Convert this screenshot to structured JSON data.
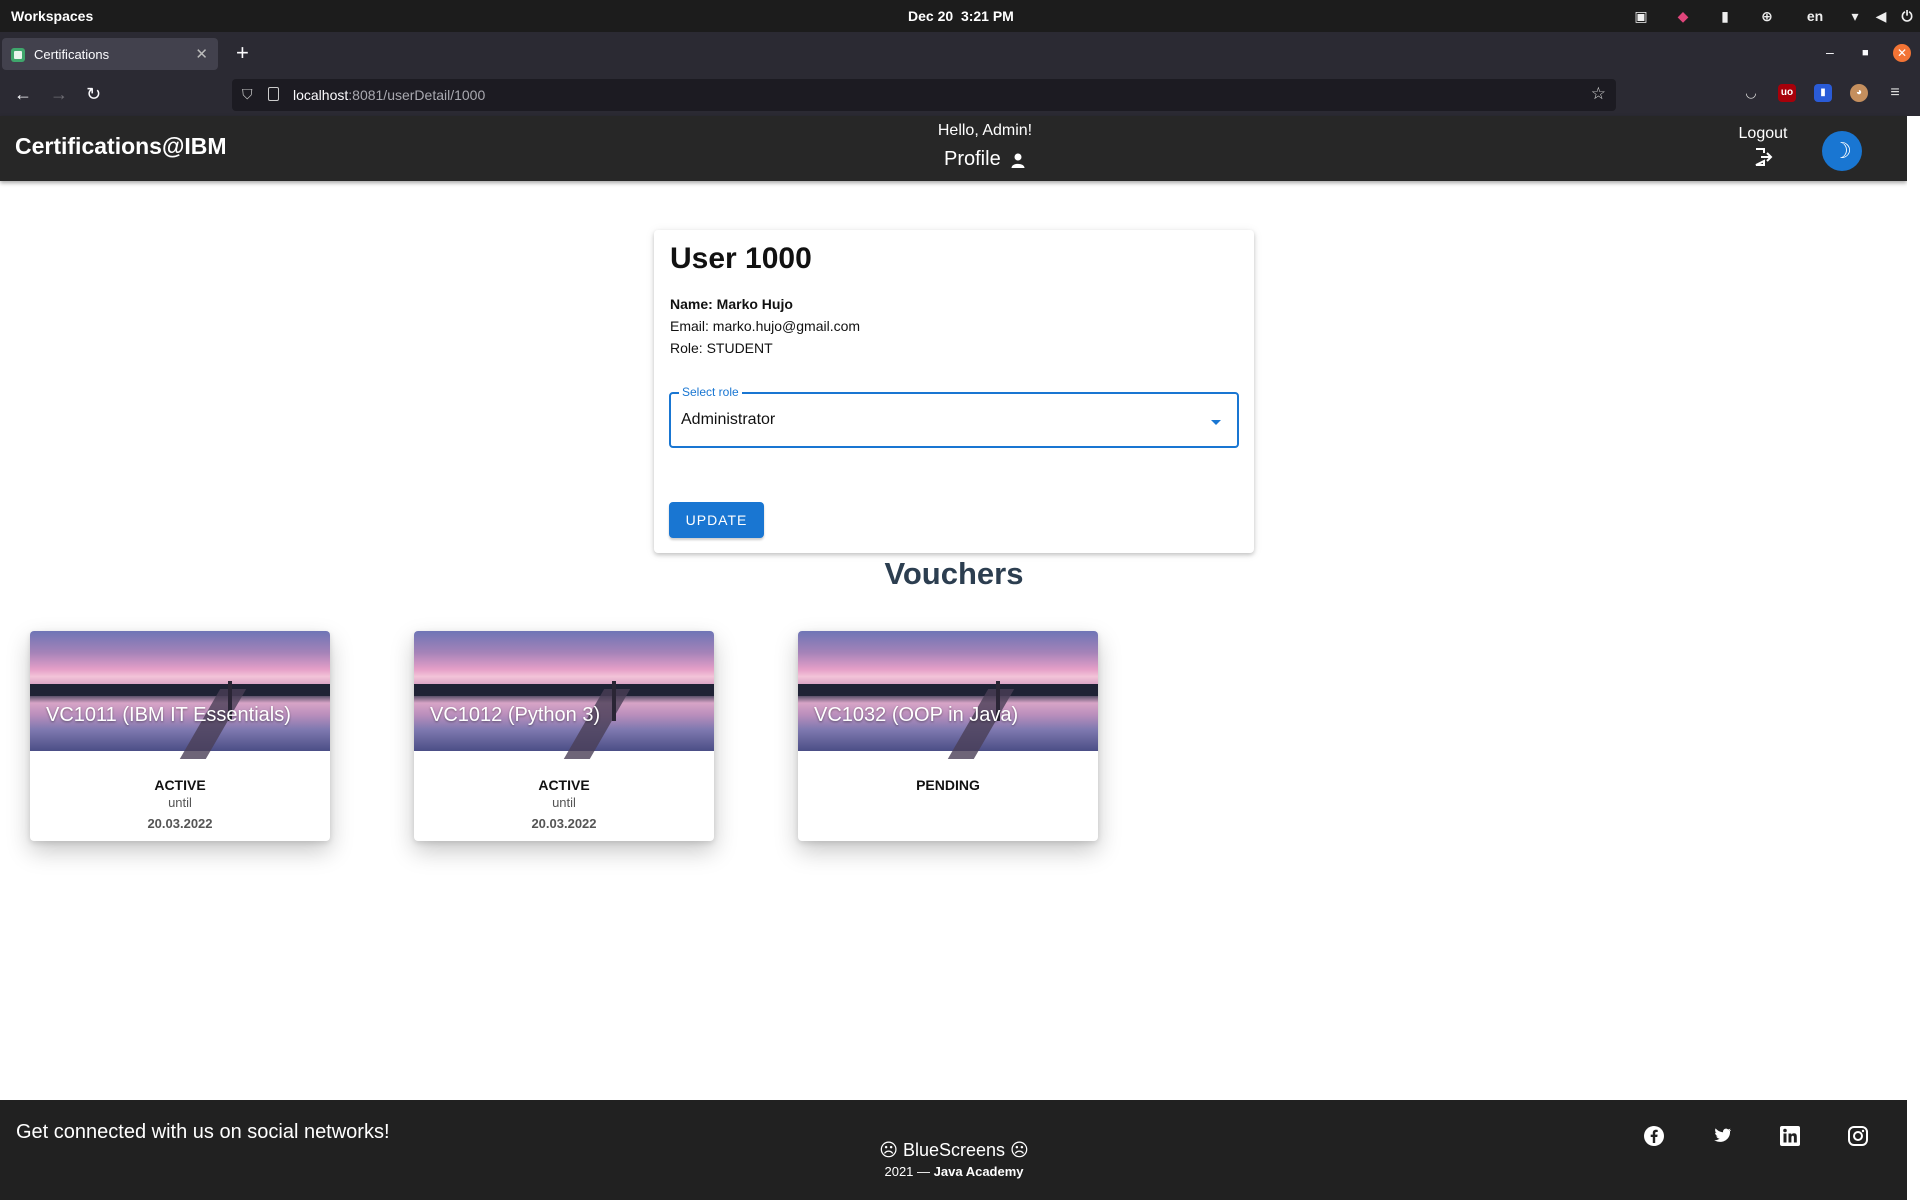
{
  "os": {
    "workspaces": "Workspaces",
    "date": "Dec 20",
    "time": "3:21 PM",
    "lang": "en"
  },
  "browser": {
    "tab_title": "Certifications",
    "url_host": "localhost",
    "url_rest": ":8081/userDetail/1000"
  },
  "header": {
    "brand": "Certifications@IBM",
    "greeting": "Hello, Admin!",
    "profile_label": "Profile",
    "logout_label": "Logout",
    "theme_icon": "moon-icon"
  },
  "user": {
    "title": "User 1000",
    "name_line": "Name: Marko Hujo",
    "email_line": "Email: marko.hujo@gmail.com",
    "role_line": "Role: STUDENT",
    "select_label": "Select role",
    "select_value": "Administrator",
    "update_label": "UPDATE"
  },
  "vouchers": {
    "title": "Vouchers",
    "items": [
      {
        "title": "VC1011 (IBM IT Essentials)",
        "status": "ACTIVE",
        "until": "until",
        "date": "20.03.2022"
      },
      {
        "title": "VC1012 (Python 3)",
        "status": "ACTIVE",
        "until": "until",
        "date": "20.03.2022"
      },
      {
        "title": "VC1032 (OOP in Java)",
        "status": "PENDING",
        "until": "",
        "date": ""
      }
    ]
  },
  "footer": {
    "connect": "Get connected with us on social networks!",
    "brand": "BlueScreens",
    "copy_prefix": "2021 —",
    "copy_org": "Java Academy",
    "social": [
      "facebook-icon",
      "twitter-icon",
      "linkedin-icon",
      "instagram-icon"
    ]
  },
  "colors": {
    "primary": "#1976d2",
    "header_bg": "#272727",
    "footer_bg": "#212121",
    "heading": "#2c3e50"
  }
}
